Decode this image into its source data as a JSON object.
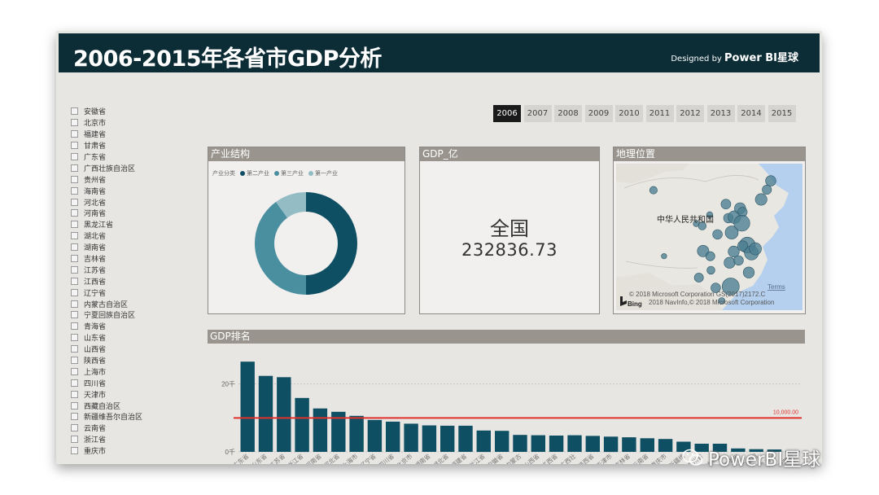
{
  "header": {
    "title": "2006-2015年各省市GDP分析",
    "designed_prefix": "Designed by",
    "designed_brand": "Power BI星球"
  },
  "provinces": [
    "安徽省",
    "北京市",
    "福建省",
    "甘肃省",
    "广东省",
    "广西壮族自治区",
    "贵州省",
    "海南省",
    "河北省",
    "河南省",
    "黑龙江省",
    "湖北省",
    "湖南省",
    "吉林省",
    "江苏省",
    "江西省",
    "辽宁省",
    "内蒙古自治区",
    "宁夏回族自治区",
    "青海省",
    "山东省",
    "山西省",
    "陕西省",
    "上海市",
    "四川省",
    "天津市",
    "西藏自治区",
    "新疆维吾尔自治区",
    "云南省",
    "浙江省",
    "重庆市"
  ],
  "years": {
    "items": [
      "2006",
      "2007",
      "2008",
      "2009",
      "2010",
      "2011",
      "2012",
      "2013",
      "2014",
      "2015"
    ],
    "selected": "2006"
  },
  "industry_panel": {
    "title": "产业结构",
    "legend_label": "产业分类",
    "legend": [
      {
        "name": "第二产业",
        "color": "#0f4f63"
      },
      {
        "name": "第三产业",
        "color": "#4a8fa0"
      },
      {
        "name": "第一产业",
        "color": "#94bcc4"
      }
    ]
  },
  "gdp_panel": {
    "title": "GDP_亿",
    "region": "全国",
    "value": "232836.73"
  },
  "geo_panel": {
    "title": "地理位置",
    "country_label": "中华人民共和国",
    "terms": "Terms",
    "bing": "Bing",
    "copyright1": "© 2018 Microsoft Corporation  GS(2017)2172.C",
    "copyright2": "2018 NavInfo,© 2018 Microsoft Corporation"
  },
  "rank_panel": {
    "title": "GDP排名",
    "ref_label": "10,000.00",
    "tick_labels": [
      "20千",
      "0千"
    ]
  },
  "chart_data": {
    "type": "bar",
    "title": "GDP排名",
    "categories": [
      "广东省",
      "山东省",
      "江苏省",
      "浙江省",
      "河南省",
      "河北省",
      "上海市",
      "辽宁省",
      "四川省",
      "北京市",
      "湖南省",
      "湖北省",
      "福建省",
      "黑龙江省",
      "安徽省",
      "内蒙古",
      "山西省",
      "江西省",
      "广西壮",
      "陕西省",
      "天津市",
      "吉林省",
      "云南省",
      "重庆市",
      "新疆维",
      "贵州省",
      "甘肃省",
      "海南省",
      "宁夏回",
      "青海省",
      "西藏自"
    ],
    "visible_labels": [
      "广东省",
      "山东省",
      "江苏省",
      "浙江省",
      "河南省",
      "河北省",
      "上海市",
      "辽宁省",
      "四川省",
      "北京市",
      "湖南省",
      "湖北省",
      "福建省",
      "黑龙江省",
      "安徽省",
      "内蒙古",
      "山西省",
      "江西省",
      "广西壮",
      "陕西省",
      "天津市",
      "吉林省",
      "云南省",
      "重庆市",
      "新疆维",
      "贵州省",
      "甘肃省",
      "海南省",
      "宁夏回",
      "青海省",
      "西藏自"
    ],
    "values": [
      26.6,
      22.4,
      22.0,
      15.9,
      12.8,
      11.8,
      10.6,
      9.4,
      8.9,
      8.3,
      7.8,
      7.7,
      7.7,
      6.3,
      6.2,
      5.0,
      4.9,
      4.8,
      4.9,
      4.7,
      4.5,
      4.3,
      4.0,
      3.8,
      3.0,
      2.4,
      2.4,
      1.0,
      0.8,
      0.7,
      0.3
    ],
    "unit": "千",
    "ylim": [
      0,
      30
    ],
    "yticks": [
      0,
      20
    ],
    "reference_line": {
      "value": 10,
      "label": "10,000.00",
      "color": "#e0302c"
    },
    "bar_color": "#0f4f63"
  },
  "donut_data": {
    "type": "pie",
    "series": [
      {
        "name": "第二产业",
        "value": 50
      },
      {
        "name": "第三产业",
        "value": 40
      },
      {
        "name": "第一产业",
        "value": 10
      }
    ]
  },
  "map_points": [
    {
      "lon": 87.6,
      "lat": 43.8,
      "w": 2.1
    },
    {
      "lon": 91.1,
      "lat": 29.6,
      "w": 0.3
    },
    {
      "lon": 101.8,
      "lat": 36.6,
      "w": 0.6
    },
    {
      "lon": 103.8,
      "lat": 36.1,
      "w": 2.3
    },
    {
      "lon": 106.3,
      "lat": 38.5,
      "w": 0.7
    },
    {
      "lon": 111.7,
      "lat": 40.8,
      "w": 5.0
    },
    {
      "lon": 108.9,
      "lat": 34.3,
      "w": 4.7
    },
    {
      "lon": 104.1,
      "lat": 30.7,
      "w": 8.7
    },
    {
      "lon": 106.5,
      "lat": 29.6,
      "w": 3.9
    },
    {
      "lon": 106.7,
      "lat": 26.6,
      "w": 2.3
    },
    {
      "lon": 102.7,
      "lat": 25.0,
      "w": 4.0
    },
    {
      "lon": 108.3,
      "lat": 22.8,
      "w": 4.9
    },
    {
      "lon": 113.3,
      "lat": 23.1,
      "w": 26.6
    },
    {
      "lon": 110.3,
      "lat": 20.0,
      "w": 1.0
    },
    {
      "lon": 112.9,
      "lat": 28.2,
      "w": 7.7
    },
    {
      "lon": 114.3,
      "lat": 30.6,
      "w": 7.6
    },
    {
      "lon": 115.9,
      "lat": 28.7,
      "w": 4.7
    },
    {
      "lon": 113.6,
      "lat": 34.7,
      "w": 12.4
    },
    {
      "lon": 112.5,
      "lat": 37.8,
      "w": 4.8
    },
    {
      "lon": 114.5,
      "lat": 38.0,
      "w": 11.7
    },
    {
      "lon": 116.4,
      "lat": 39.9,
      "w": 8.1
    },
    {
      "lon": 117.2,
      "lat": 39.1,
      "w": 4.5
    },
    {
      "lon": 117.0,
      "lat": 36.7,
      "w": 22.1
    },
    {
      "lon": 118.8,
      "lat": 32.0,
      "w": 21.6
    },
    {
      "lon": 117.3,
      "lat": 31.8,
      "w": 6.1
    },
    {
      "lon": 120.2,
      "lat": 30.3,
      "w": 15.7
    },
    {
      "lon": 121.5,
      "lat": 31.2,
      "w": 10.4
    },
    {
      "lon": 119.3,
      "lat": 26.1,
      "w": 7.6
    },
    {
      "lon": 123.4,
      "lat": 41.8,
      "w": 9.3
    },
    {
      "lon": 125.3,
      "lat": 43.9,
      "w": 4.3
    },
    {
      "lon": 126.6,
      "lat": 45.8,
      "w": 6.2
    }
  ]
}
